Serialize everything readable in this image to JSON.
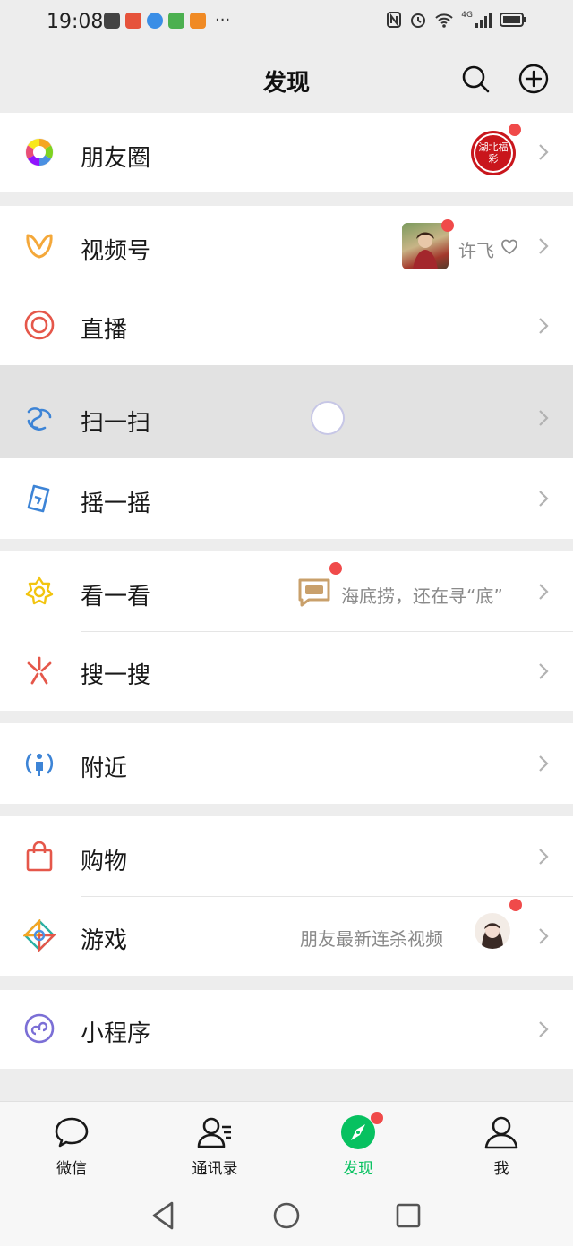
{
  "status_bar": {
    "time": "19:08",
    "more": "···",
    "network": "4G"
  },
  "header": {
    "title": "发现"
  },
  "menu": {
    "moments": {
      "label": "朋友圈",
      "avatar_text": "湖北福彩"
    },
    "channels": {
      "label": "视频号",
      "author": "许飞"
    },
    "live": {
      "label": "直播"
    },
    "scan": {
      "label": "扫一扫"
    },
    "shake": {
      "label": "摇一摇"
    },
    "top_stories": {
      "label": "看一看",
      "hint": "海底捞，还在寻“底”"
    },
    "search": {
      "label": "搜一搜"
    },
    "nearby": {
      "label": "附近"
    },
    "shopping": {
      "label": "购物"
    },
    "games": {
      "label": "游戏",
      "hint": "朋友最新连杀视频"
    },
    "mini_programs": {
      "label": "小程序"
    }
  },
  "tabs": [
    {
      "label": "微信"
    },
    {
      "label": "通讯录"
    },
    {
      "label": "发现"
    },
    {
      "label": "我"
    }
  ],
  "colors": {
    "accent": "#07c160",
    "badge": "#f04a4a",
    "background": "#ededed"
  }
}
